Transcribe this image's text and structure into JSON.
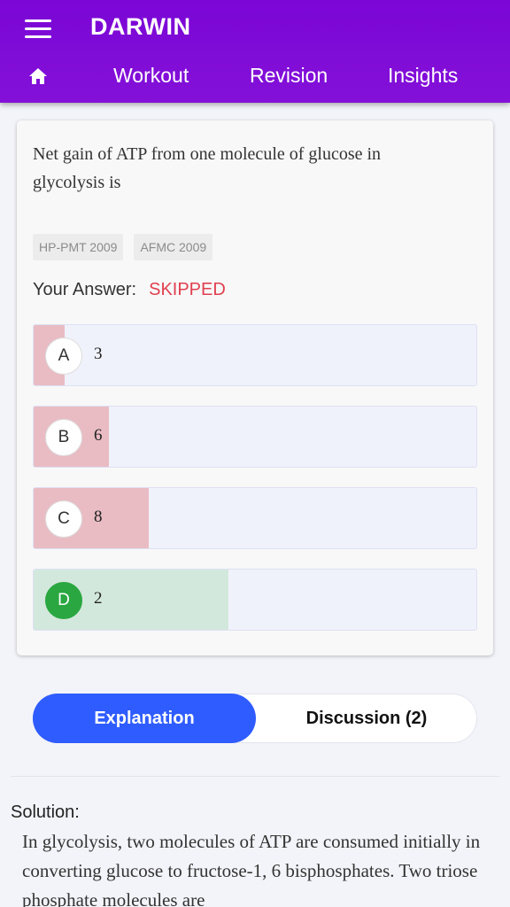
{
  "app": {
    "title": "DARWIN"
  },
  "nav": {
    "items": [
      {
        "label": "Workout"
      },
      {
        "label": "Revision"
      },
      {
        "label": "Insights"
      }
    ]
  },
  "question": {
    "text": "Net gain of ATP from one molecule of glucose in glycolysis is",
    "tags": [
      "HP-PMT 2009",
      "AFMC 2009"
    ],
    "answer_label": "Your Answer:",
    "answer_value": "SKIPPED",
    "options": [
      {
        "letter": "A",
        "text": "3",
        "selection_share": 0.07,
        "status": "wrong"
      },
      {
        "letter": "B",
        "text": "6",
        "selection_share": 0.17,
        "status": "wrong"
      },
      {
        "letter": "C",
        "text": "8",
        "selection_share": 0.26,
        "status": "wrong"
      },
      {
        "letter": "D",
        "text": "2",
        "selection_share": 0.44,
        "status": "correct"
      }
    ]
  },
  "colors": {
    "brand": "#7b06d6",
    "wrong_fill": "#e9bcc4",
    "correct_fill": "#d3e8dc",
    "correct_badge": "#2aa741",
    "skipped": "#e04050",
    "tab_active": "#2f5cff"
  },
  "tabs": {
    "explanation": "Explanation",
    "discussion": "Discussion (2)"
  },
  "solution": {
    "heading": "Solution:",
    "text": "In glycolysis, two molecules of ATP are consumed initially in converting glucose to fructose-1, 6 bisphosphates. Two triose phosphate molecules are"
  }
}
